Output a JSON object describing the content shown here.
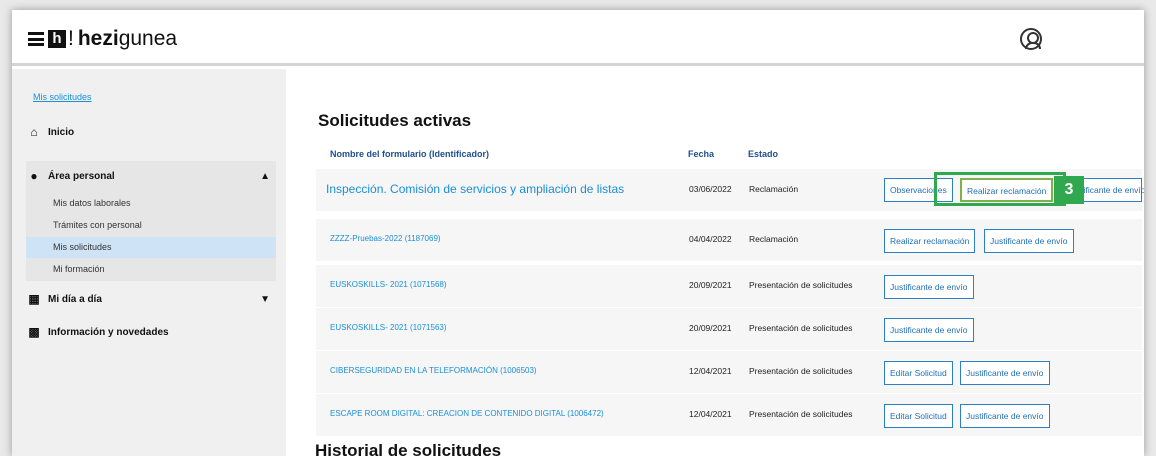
{
  "header": {
    "logo_mark": "h",
    "logo_excl": "!",
    "logo_bold": "hezi",
    "logo_rest": "gunea",
    "user_icon": "user-circle-icon"
  },
  "breadcrumb": "Mis solicitudes",
  "sidebar": {
    "inicio": "Inicio",
    "area_personal": "Área personal",
    "sub_items": [
      "Mis datos laborales",
      "Trámites con personal",
      "Mis solicitudes",
      "Mi formación"
    ],
    "mi_dia": "Mi día a día",
    "info": "Información y novedades",
    "active_item": "Mis solicitudes"
  },
  "main": {
    "title": "Solicitudes activas",
    "history_title": "Historial de solicitudes",
    "columns": {
      "name": "Nombre del formulario (Identificador)",
      "date": "Fecha",
      "state": "Estado"
    },
    "rows": [
      {
        "name": "Inspección. Comisión de servicios y ampliación de listas",
        "date": "03/06/2022",
        "state": "Reclamación",
        "buttons": [
          "Observaciones",
          "Realizar reclamación",
          "Justificante de envío"
        ]
      },
      {
        "name": "ZZZZ-Pruebas-2022 (1187069)",
        "date": "04/04/2022",
        "state": "Reclamación",
        "buttons": [
          "Realizar reclamación",
          "Justificante de envío"
        ]
      },
      {
        "name": "EUSKOSKILLS- 2021 (1071568)",
        "date": "20/09/2021",
        "state": "Presentación de solicitudes",
        "buttons": [
          "Justificante de envío"
        ]
      },
      {
        "name": "EUSKOSKILLS- 2021 (1071563)",
        "date": "20/09/2021",
        "state": "Presentación de solicitudes",
        "buttons": [
          "Justificante de envío"
        ]
      },
      {
        "name": "CIBERSEGURIDAD EN LA TELEFORMACIÓN (1006503)",
        "date": "12/04/2021",
        "state": "Presentación de solicitudes",
        "buttons": [
          "Editar Solicitud",
          "Justificante de envío"
        ]
      },
      {
        "name": "ESCAPE ROOM DIGITAL: CREACION DE CONTENIDO DIGITAL (1006472)",
        "date": "12/04/2021",
        "state": "Presentación de solicitudes",
        "buttons": [
          "Editar Solicitud",
          "Justificante de envío"
        ]
      }
    ]
  },
  "annotation": {
    "step_number": "3",
    "color": "#2fa84f"
  }
}
